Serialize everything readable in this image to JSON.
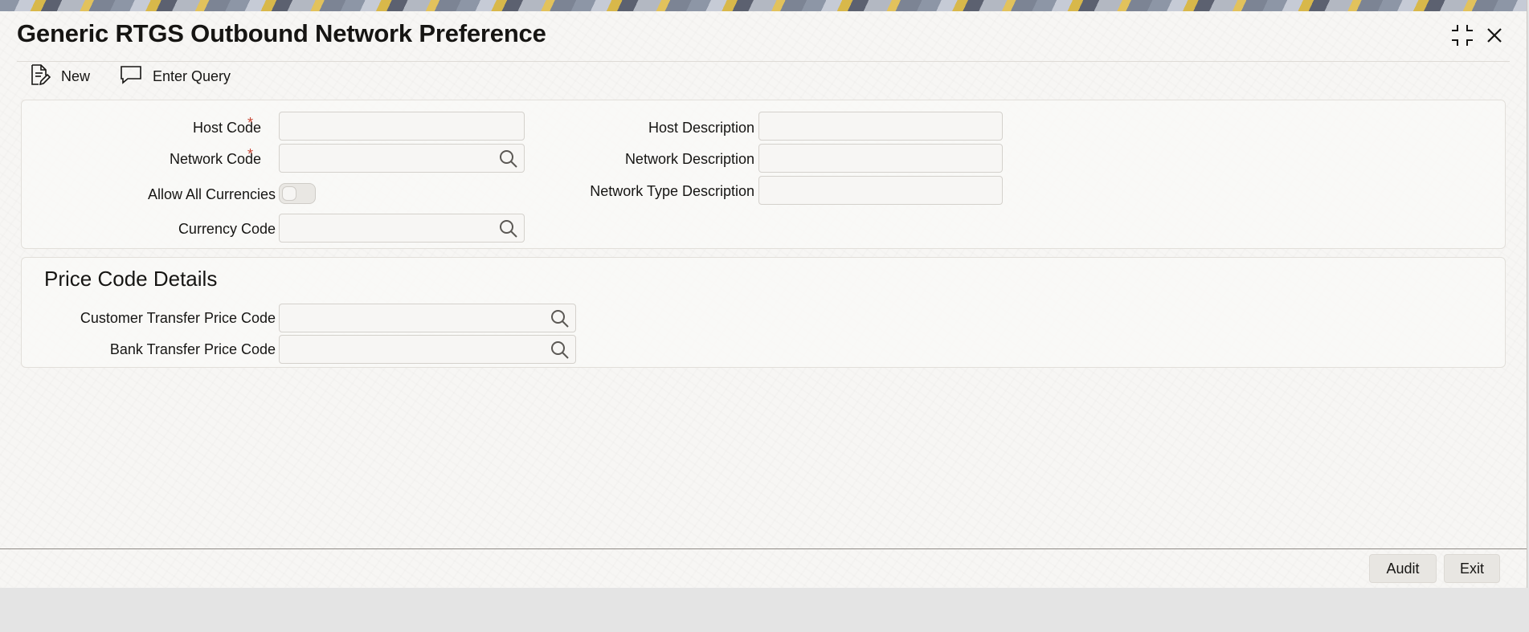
{
  "window": {
    "title": "Generic RTGS Outbound Network Preference"
  },
  "window_controls": [
    {
      "name": "collapse-icon",
      "icon": "collapse-icon"
    },
    {
      "name": "close-icon",
      "icon": "close-icon"
    }
  ],
  "toolbar": {
    "new_label": "New",
    "new_icon": "new-document-icon",
    "enter_query_label": "Enter Query",
    "enter_query_icon": "speech-bubble-icon"
  },
  "main": {
    "host_code": {
      "label": "Host Code",
      "required": "*",
      "value": ""
    },
    "network_code": {
      "label": "Network Code",
      "required": "*",
      "value": "",
      "icon": "search-icon"
    },
    "allow_all_currencies": {
      "label": "Allow All Currencies",
      "checked": false
    },
    "currency_code": {
      "label": "Currency Code",
      "value": "",
      "icon": "search-icon"
    },
    "host_description": {
      "label": "Host Description",
      "value": ""
    },
    "network_description": {
      "label": "Network Description",
      "value": ""
    },
    "network_type_description": {
      "label": "Network Type Description",
      "value": ""
    }
  },
  "price_code_details": {
    "title": "Price Code Details",
    "customer_transfer_price_code": {
      "label": "Customer Transfer Price Code",
      "value": "",
      "icon": "search-icon"
    },
    "bank_transfer_price_code": {
      "label": "Bank Transfer Price Code",
      "value": "",
      "icon": "search-icon"
    }
  },
  "footer": {
    "audit_label": "Audit",
    "exit_label": "Exit"
  },
  "colors": {
    "required_marker": "#c74634",
    "text": "#161513",
    "panel_bg": "#f9f8f6",
    "field_border": "#d4d1cc"
  }
}
